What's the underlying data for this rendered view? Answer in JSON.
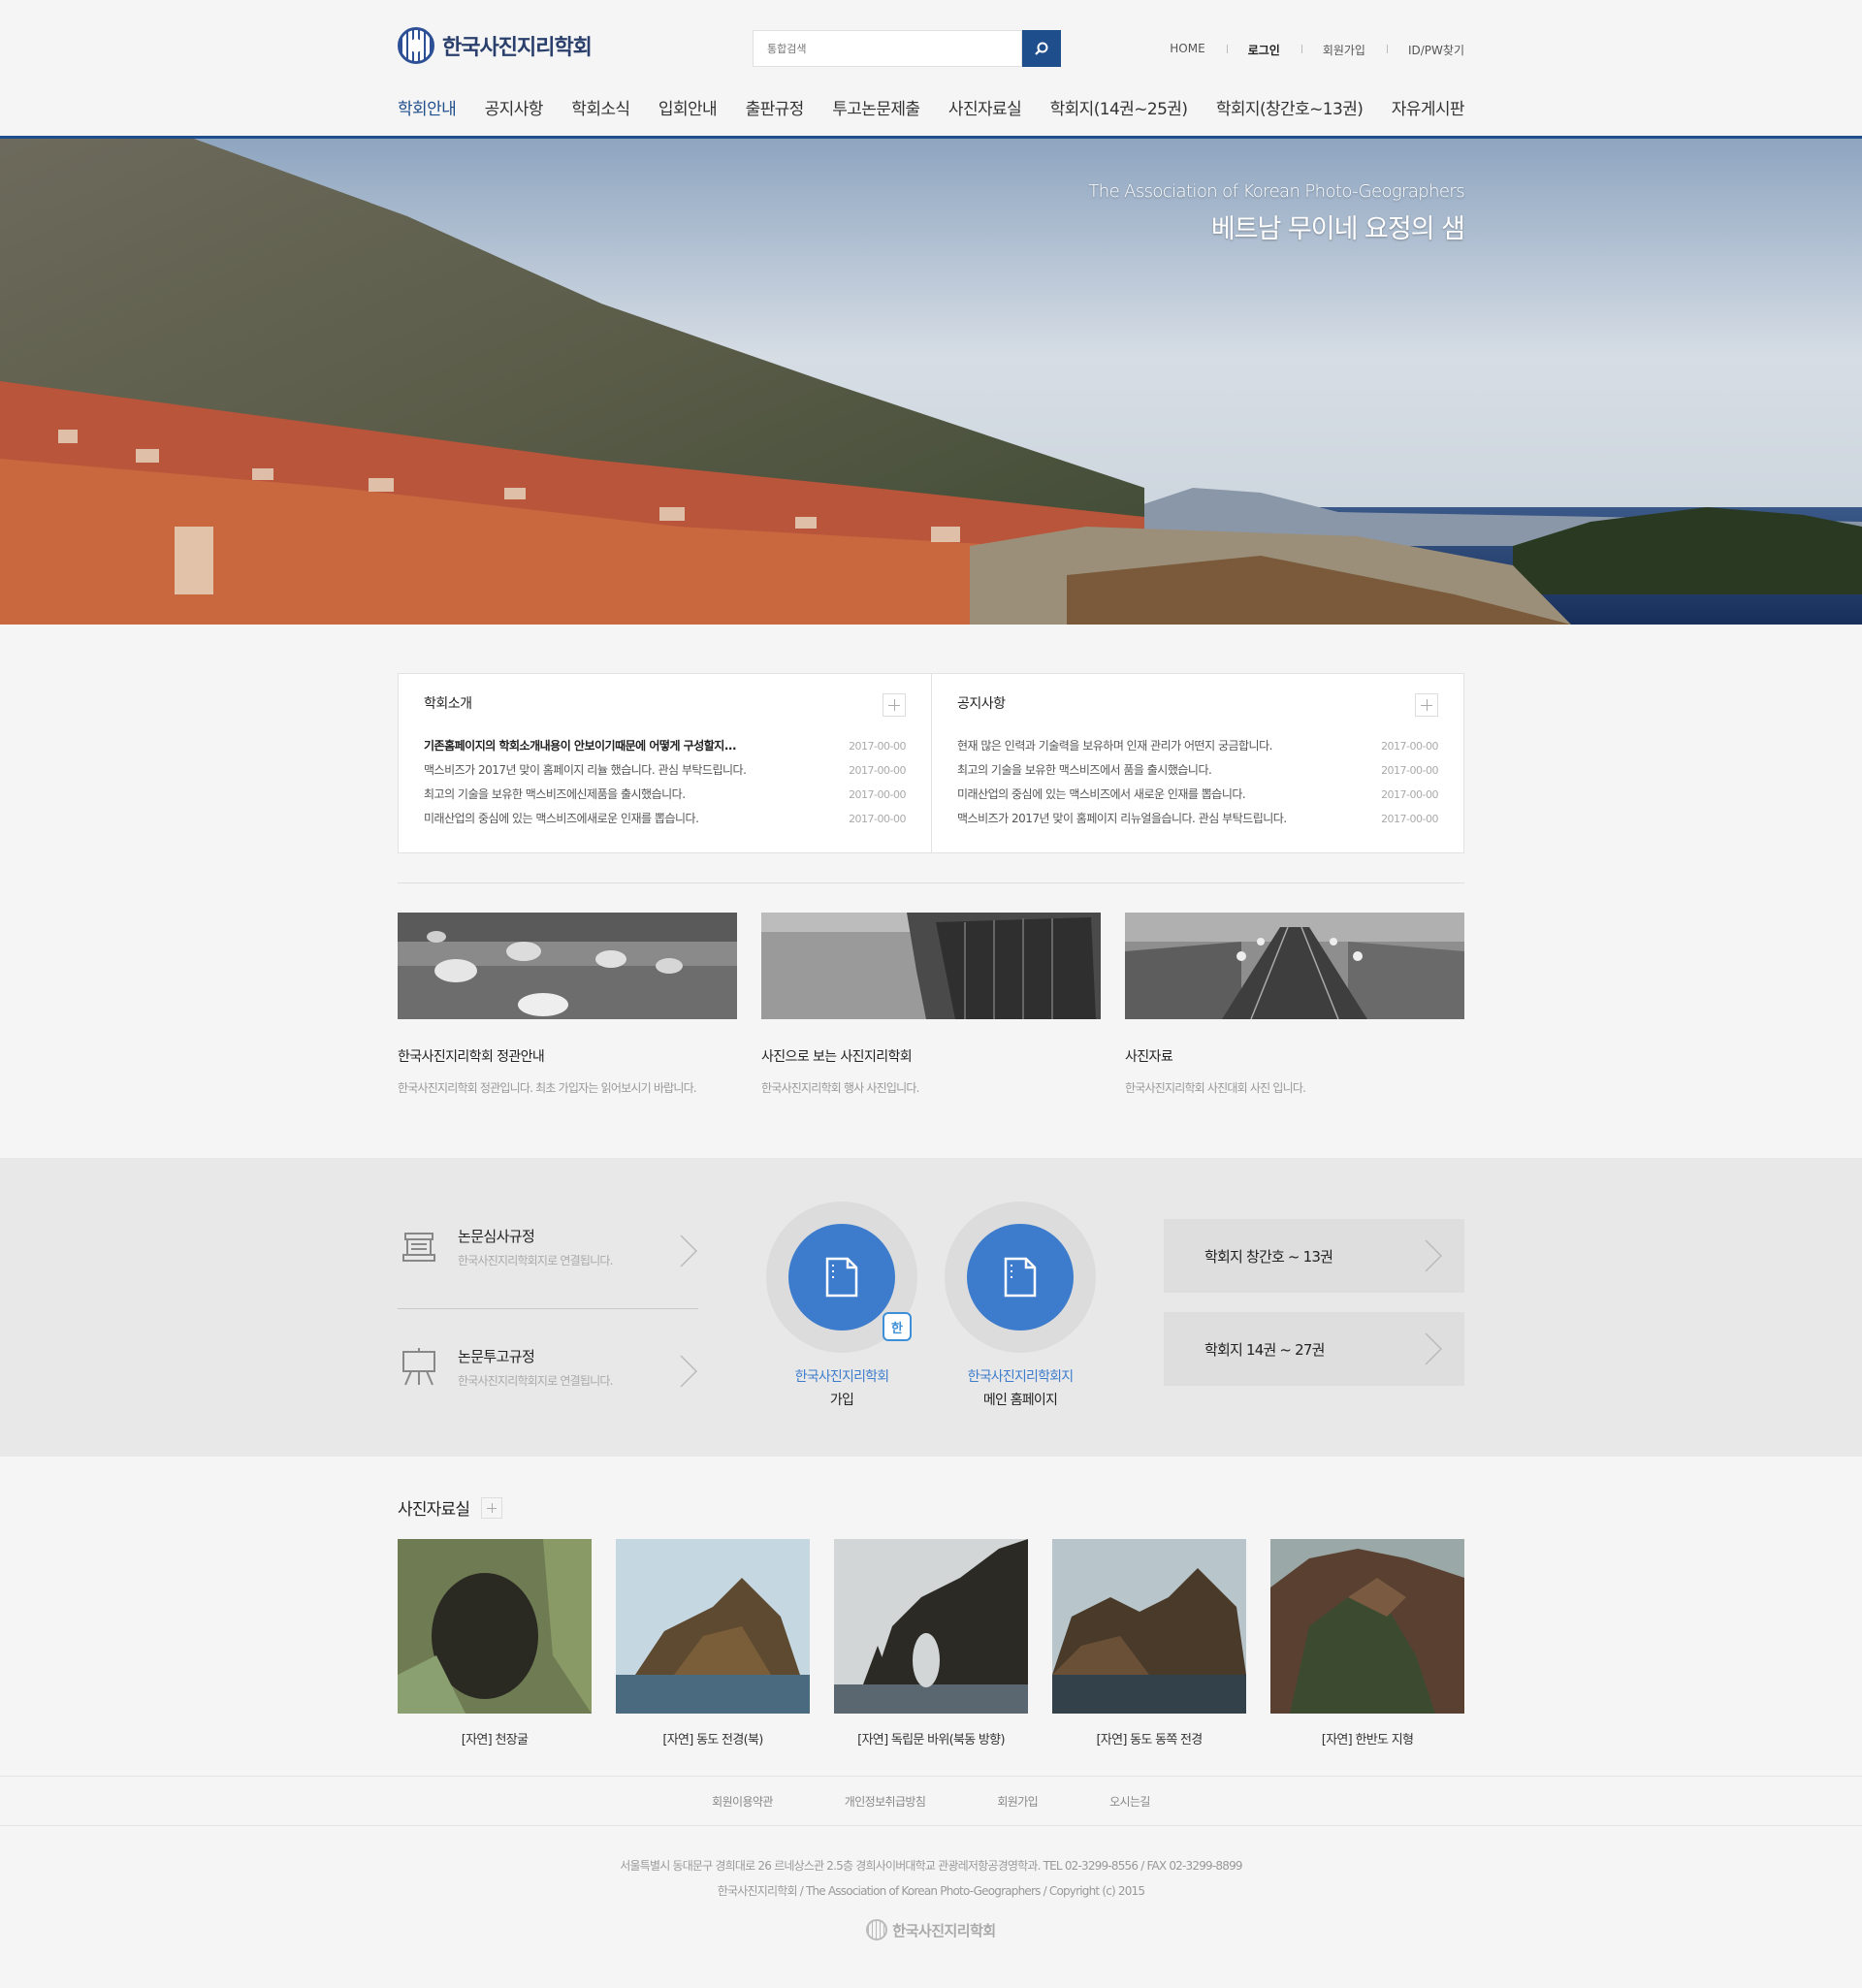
{
  "header": {
    "logo_text": "한국사진지리학회",
    "search_placeholder": "통합검색",
    "util": [
      "HOME",
      "로그인",
      "회원가입",
      "ID/PW찾기"
    ],
    "nav": [
      "학회안내",
      "공지사항",
      "학회소식",
      "입회안내",
      "출판규정",
      "투고논문제출",
      "사진자료실",
      "학회지(14권~25권)",
      "학회지(창간호~13권)",
      "자유게시판"
    ]
  },
  "hero": {
    "title_en": "The Association of Korean Photo-Geographers",
    "title_kr": "베트남 무이네 요정의 샘"
  },
  "boards": [
    {
      "title": "학회소개",
      "items": [
        {
          "text": "기존홈페이지의 학회소개내용이 안보이기때문에 어떻게 구성할지...",
          "date": "2017-00-00",
          "strong": true
        },
        {
          "text": "맥스비즈가 2017년 맞이 홈페이지 리뉼 했습니다. 관심 부탁드립니다.",
          "date": "2017-00-00"
        },
        {
          "text": "최고의 기술을 보유한 맥스비즈에신제품을 출시했습니다.",
          "date": "2017-00-00"
        },
        {
          "text": "미래산업의 중심에 있는 맥스비즈에새로운 인재를 뽑습니다.",
          "date": "2017-00-00"
        }
      ]
    },
    {
      "title": "공지사항",
      "items": [
        {
          "text": "현재 많은 인력과 기술력을 보유하며 인재 관리가 어떤지 궁금합니다.",
          "date": "2017-00-00"
        },
        {
          "text": "최고의 기술을 보유한 맥스비즈에서 품을 출시했습니다.",
          "date": "2017-00-00"
        },
        {
          "text": "미래산업의 중심에 있는 맥스비즈에서 새로운 인재를 뽑습니다.",
          "date": "2017-00-00"
        },
        {
          "text": "맥스비즈가 2017년 맞이 홈페이지 리뉴얼을습니다. 관심 부탁드립니다.",
          "date": "2017-00-00"
        }
      ]
    }
  ],
  "features": [
    {
      "title": "한국사진지리학회 정관안내",
      "desc": "한국사진지리학회 정관입니다. 최초 가입자는 읽어보시기 바랍니다."
    },
    {
      "title": "사진으로 보는 사진지리학회",
      "desc": "한국사진지리학회 행사 사진입니다."
    },
    {
      "title": "사진자료",
      "desc": "한국사진지리학회 사진대회 사진 입니다."
    }
  ],
  "band": {
    "regs": [
      {
        "title": "논문심사규정",
        "desc": "한국사진지리학회지로 연결됩니다."
      },
      {
        "title": "논문투고규정",
        "desc": "한국사진지리학회지로 연결됩니다."
      }
    ],
    "circles": [
      {
        "line1": "한국사진지리학회",
        "line2": "가입",
        "badge": "한"
      },
      {
        "line1": "한국사진지리학회지",
        "line2": "메인 홈페이지"
      }
    ],
    "volumes": [
      "학회지 창간호 ~ 13권",
      "학회지 14권 ~ 27권"
    ]
  },
  "gallery": {
    "title": "사진자료실",
    "items": [
      "[자연] 천장굴",
      "[자연] 동도 전경(북)",
      "[자연] 독립문 바위(북동 방향)",
      "[자연] 동도 동쪽 전경",
      "[자연] 한반도 지형"
    ]
  },
  "footer": {
    "links": [
      "회원이용약관",
      "개인정보취급방침",
      "회원가입",
      "오시는길"
    ],
    "address": "서울특별시 동대문구 경희대로 26 르네상스관 2.5층 경희사이버대학교 관광레저항공경영학과. TEL 02-3299-8556 / FAX 02-3299-8899",
    "copyright": "한국사진지리학회 / The Association of Korean Photo-Geographers / Copyright (c) 2015",
    "logo_text": "한국사진지리학회"
  }
}
